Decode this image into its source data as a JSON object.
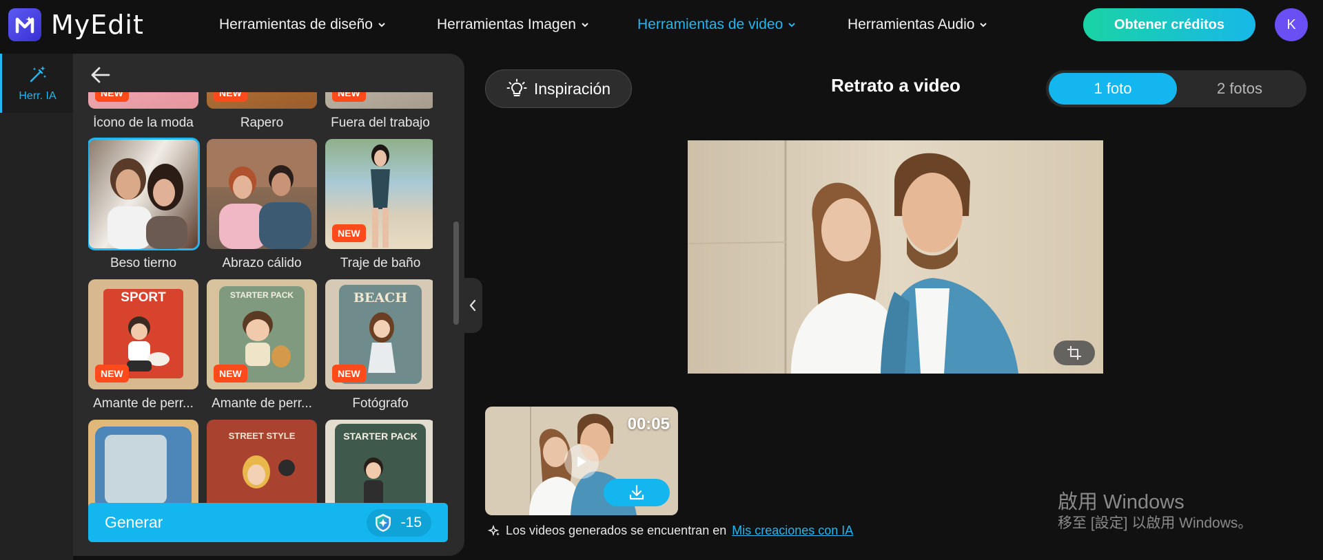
{
  "app": {
    "brand": "MyEdit"
  },
  "nav": {
    "items": [
      {
        "label": "Herramientas de diseño"
      },
      {
        "label": "Herramientas Imagen"
      },
      {
        "label": "Herramientas de video"
      },
      {
        "label": "Herramientas Audio"
      }
    ],
    "cta_label": "Obtener créditos",
    "avatar_initial": "K"
  },
  "sidebar": {
    "items": [
      {
        "label": "Herr. IA"
      }
    ]
  },
  "panel": {
    "templates": [
      {
        "label": "Ícono de la moda",
        "badge": "NEW"
      },
      {
        "label": "Rapero",
        "badge": "NEW"
      },
      {
        "label": "Fuera del trabajo",
        "badge": "NEW"
      },
      {
        "label": "Beso tierno",
        "badge": ""
      },
      {
        "label": "Abrazo cálido",
        "badge": ""
      },
      {
        "label": "Traje de baño",
        "badge": "NEW"
      },
      {
        "label": "Amante de perr...",
        "badge": "NEW",
        "art": "SPORT"
      },
      {
        "label": "Amante de perr...",
        "badge": "NEW",
        "art": "STARTER PACK"
      },
      {
        "label": "Fotógrafo",
        "badge": "NEW",
        "art": "BEACH"
      },
      {
        "label": "",
        "badge": "",
        "art": ""
      },
      {
        "label": "",
        "badge": "",
        "art": "STREET STYLE"
      },
      {
        "label": "",
        "badge": "",
        "art": "STARTER PACK"
      }
    ],
    "generate_label": "Generar",
    "cost": "-15"
  },
  "main": {
    "inspiration_label": "Inspiración",
    "title": "Retrato a video",
    "segments": [
      "1 foto",
      "2 fotos"
    ],
    "video": {
      "duration": "00:05"
    },
    "note_text": "Los videos generados se encuentran en",
    "note_link": "Mis creaciones con IA"
  },
  "watermark": {
    "line1": "啟用 Windows",
    "line2": "移至 [設定] 以啟用 Windows。"
  },
  "colors": {
    "accent": "#13b6ee",
    "new_badge": "#ff4a1c",
    "background": "#111111",
    "panel": "#2b2b2b"
  }
}
